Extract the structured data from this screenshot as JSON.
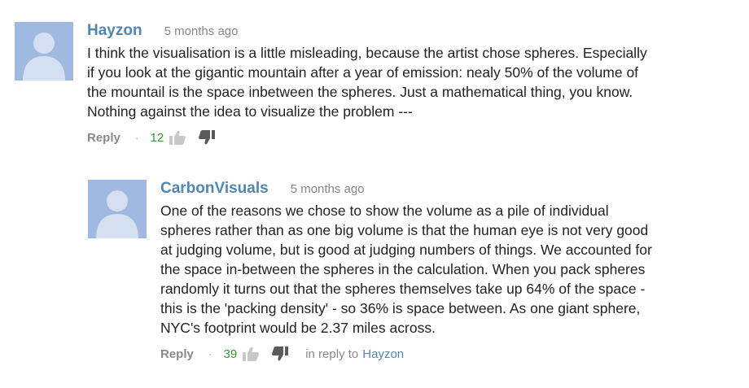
{
  "comments": [
    {
      "author": "Hayzon",
      "time": "5 months ago",
      "lines": [
        "I think the visualisation is a little misleading, because the artist chose spheres. Especially",
        "if you look at the gigantic mountain after a year of emission: nealy 50% of the volume of",
        "the mountail is the space inbetween the spheres. Just a mathematical thing, you know.",
        "Nothing against the idea to visualize the problem ---"
      ],
      "reply_label": "Reply",
      "separator": "·",
      "score": "12"
    },
    {
      "author": "CarbonVisuals",
      "time": "5 months ago",
      "lines": [
        "One of the reasons we chose to show the volume as a pile of individual",
        "spheres rather than as one big volume is that the human eye is not very good",
        "at judging volume, but is good at judging numbers of things. We accounted for",
        "the space in-between the spheres in the calculation. When you pack spheres",
        "randomly it turns out that the spheres themselves take up 64% of the space -",
        "this is the 'packing density' - so 36% is space between. As one giant sphere,",
        "NYC's footprint would be 2.37 miles across."
      ],
      "reply_label": "Reply",
      "separator": "·",
      "score": "39",
      "in_reply_to_prefix": "in reply to",
      "in_reply_to_name": "Hayzon"
    }
  ],
  "icons": {
    "avatar": "default-user-avatar-icon",
    "like": "thumbs-up-icon",
    "dislike": "thumbs-down-icon"
  },
  "colors": {
    "author_link": "#4d86b9",
    "score_positive": "#2f9a2f",
    "avatar_bg": "#9fb9e0",
    "muted": "#8a8a8a"
  }
}
